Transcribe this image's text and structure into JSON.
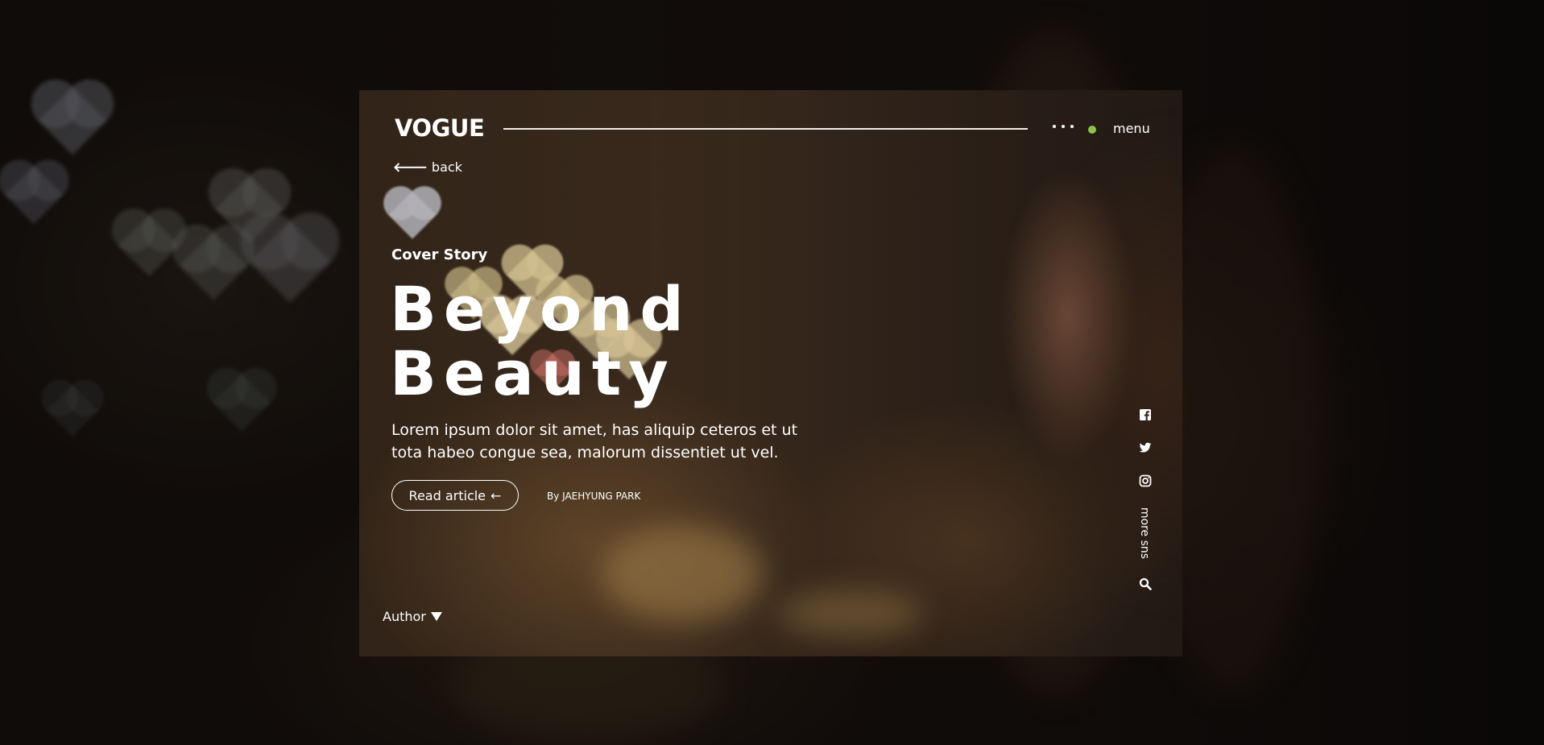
{
  "brand": {
    "logo": "VOGUE"
  },
  "header": {
    "menu_label": "menu",
    "more_icon": "ellipsis-icon",
    "status_color": "#8bc34a"
  },
  "nav": {
    "back_label": "back",
    "back_icon": "arrow-left-icon"
  },
  "hero": {
    "kicker": "Cover Story",
    "title_line1": "Beyond",
    "title_line2": "Beauty",
    "lead": "Lorem ipsum dolor sit amet, has aliquip ceteros et ut tota habeo congue sea, malorum dissentiet ut vel.",
    "cta_label": "Read article",
    "cta_arrow": "←",
    "byline": "By JAEHYUNG PARK"
  },
  "author_toggle": {
    "label": "Author",
    "icon": "caret-down-icon"
  },
  "social": {
    "icons": [
      "facebook-icon",
      "twitter-icon",
      "instagram-icon",
      "search-icon"
    ],
    "more_label": "more sns"
  }
}
